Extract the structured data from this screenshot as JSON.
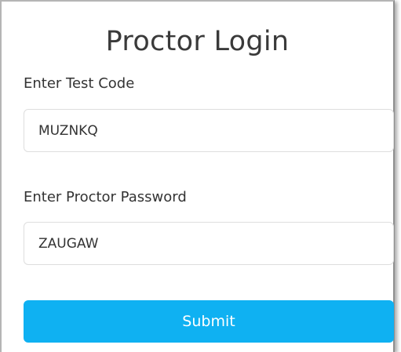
{
  "form": {
    "title": "Proctor Login",
    "test_code": {
      "label": "Enter Test Code",
      "value": "MUZNKQ"
    },
    "proctor_password": {
      "label": "Enter Proctor Password",
      "value": "ZAUGAW"
    },
    "submit_label": "Submit",
    "accent_color": "#0fb1f2"
  }
}
